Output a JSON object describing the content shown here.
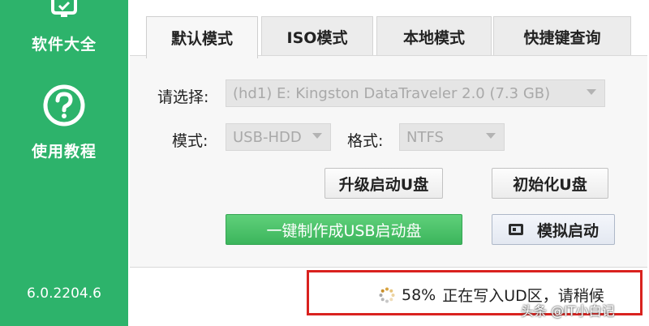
{
  "sidebar": {
    "items": [
      {
        "label": "软件大全",
        "icon": "monitor-icon"
      },
      {
        "label": "使用教程",
        "icon": "help-circle-icon"
      }
    ],
    "version": "6.0.2204.6"
  },
  "tabs": [
    {
      "label": "默认模式",
      "active": true
    },
    {
      "label": "ISO模式",
      "active": false
    },
    {
      "label": "本地模式",
      "active": false
    },
    {
      "label": "快捷键查询",
      "active": false
    }
  ],
  "form": {
    "select_label": "请选择:",
    "device_value": "(hd1) E: Kingston DataTraveler 2.0 (7.3 GB)",
    "mode_label": "模式:",
    "mode_value": "USB-HDD",
    "format_label": "格式:",
    "format_value": "NTFS"
  },
  "buttons": {
    "upgrade": "升级启动U盘",
    "initialize": "初始化U盘",
    "create": "一键制作成USB启动盘",
    "simulate": "模拟启动"
  },
  "status": {
    "percent": "58%",
    "text": "正在写入UD区，请稍候"
  },
  "watermark": "头条 @IT小白记",
  "colors": {
    "sidebar": "#2db36b",
    "primary_button": "#3cb55c",
    "highlight_border": "#d9221f"
  }
}
